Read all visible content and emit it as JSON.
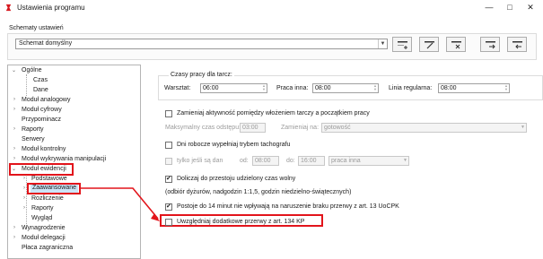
{
  "window": {
    "title": "Ustawienia programu",
    "controls": [
      "—",
      "□",
      "✕"
    ]
  },
  "schemes": {
    "group_label": "Schematy ustawień",
    "selected": "Schemat domyślny"
  },
  "tree": {
    "ogolne": "Ogólne",
    "czas": "Czas",
    "dane": "Dane",
    "modul_analogowy": "Moduł analogowy",
    "modul_cyfrowy": "Moduł cyfrowy",
    "przypominacz": "Przypominacz",
    "raporty": "Raporty",
    "serwery": "Serwery",
    "modul_kontrolny": "Moduł kontrolny",
    "modul_wykrywania": "Moduł wykrywania manipulacji",
    "modul_ewidencji": "Moduł ewidencji",
    "podstawowe": "Podstawowe",
    "zaawansowane": "Zaawansowane",
    "rozliczenie": "Rozliczenie",
    "raporty2": "Raporty",
    "wyglad": "Wygląd",
    "wynagrodzenie": "Wynagrodzenie",
    "modul_delegacji": "Moduł delegacji",
    "placa_zagraniczna": "Płaca zagraniczna"
  },
  "settings": {
    "czasy_label": "Czasy pracy dla tarcz:",
    "warsztat_label": "Warsztat:",
    "warsztat_value": "06:00",
    "praca_inna_label": "Praca inna:",
    "praca_inna_value": "08:00",
    "linia_label": "Linia regularna:",
    "linia_value": "08:00",
    "zamieniaj_label": "Zamieniaj aktywność pomiędzy włożeniem tarczy a początkiem pracy",
    "maks_label": "Maksymalny czas odstępu:",
    "maks_value": "03:00",
    "zamieniaj_na_label": "Zamieniaj na:",
    "zamieniaj_na_value": "gotowość",
    "dni_label": "Dni robocze wypełniaj trybem tachografu",
    "tylko_label": "tylko jeśli są dan",
    "od_label": "od:",
    "od_value": "08:00",
    "do_label": "do:",
    "do_value": "16:00",
    "praca_inna_select": "praca inna",
    "doliczaj_label": "Doliczaj do przestoju udzielony czas wolny",
    "odbior_text": "(odbiór dyżurów, nadgodzin 1:1,5, godzin niedzielno-świątecznych)",
    "postoj_label": "Postoje do 14 minut nie wpływają na naruszenie braku przerwy z art. 13 UoCPK",
    "uwzgledniaj_label": "Uwzględniaj dodatkowe przerwy z art. 134 KP"
  },
  "colors": {
    "highlight": "#e2141b",
    "selection": "#cce4f7",
    "accent": "#d71920"
  }
}
